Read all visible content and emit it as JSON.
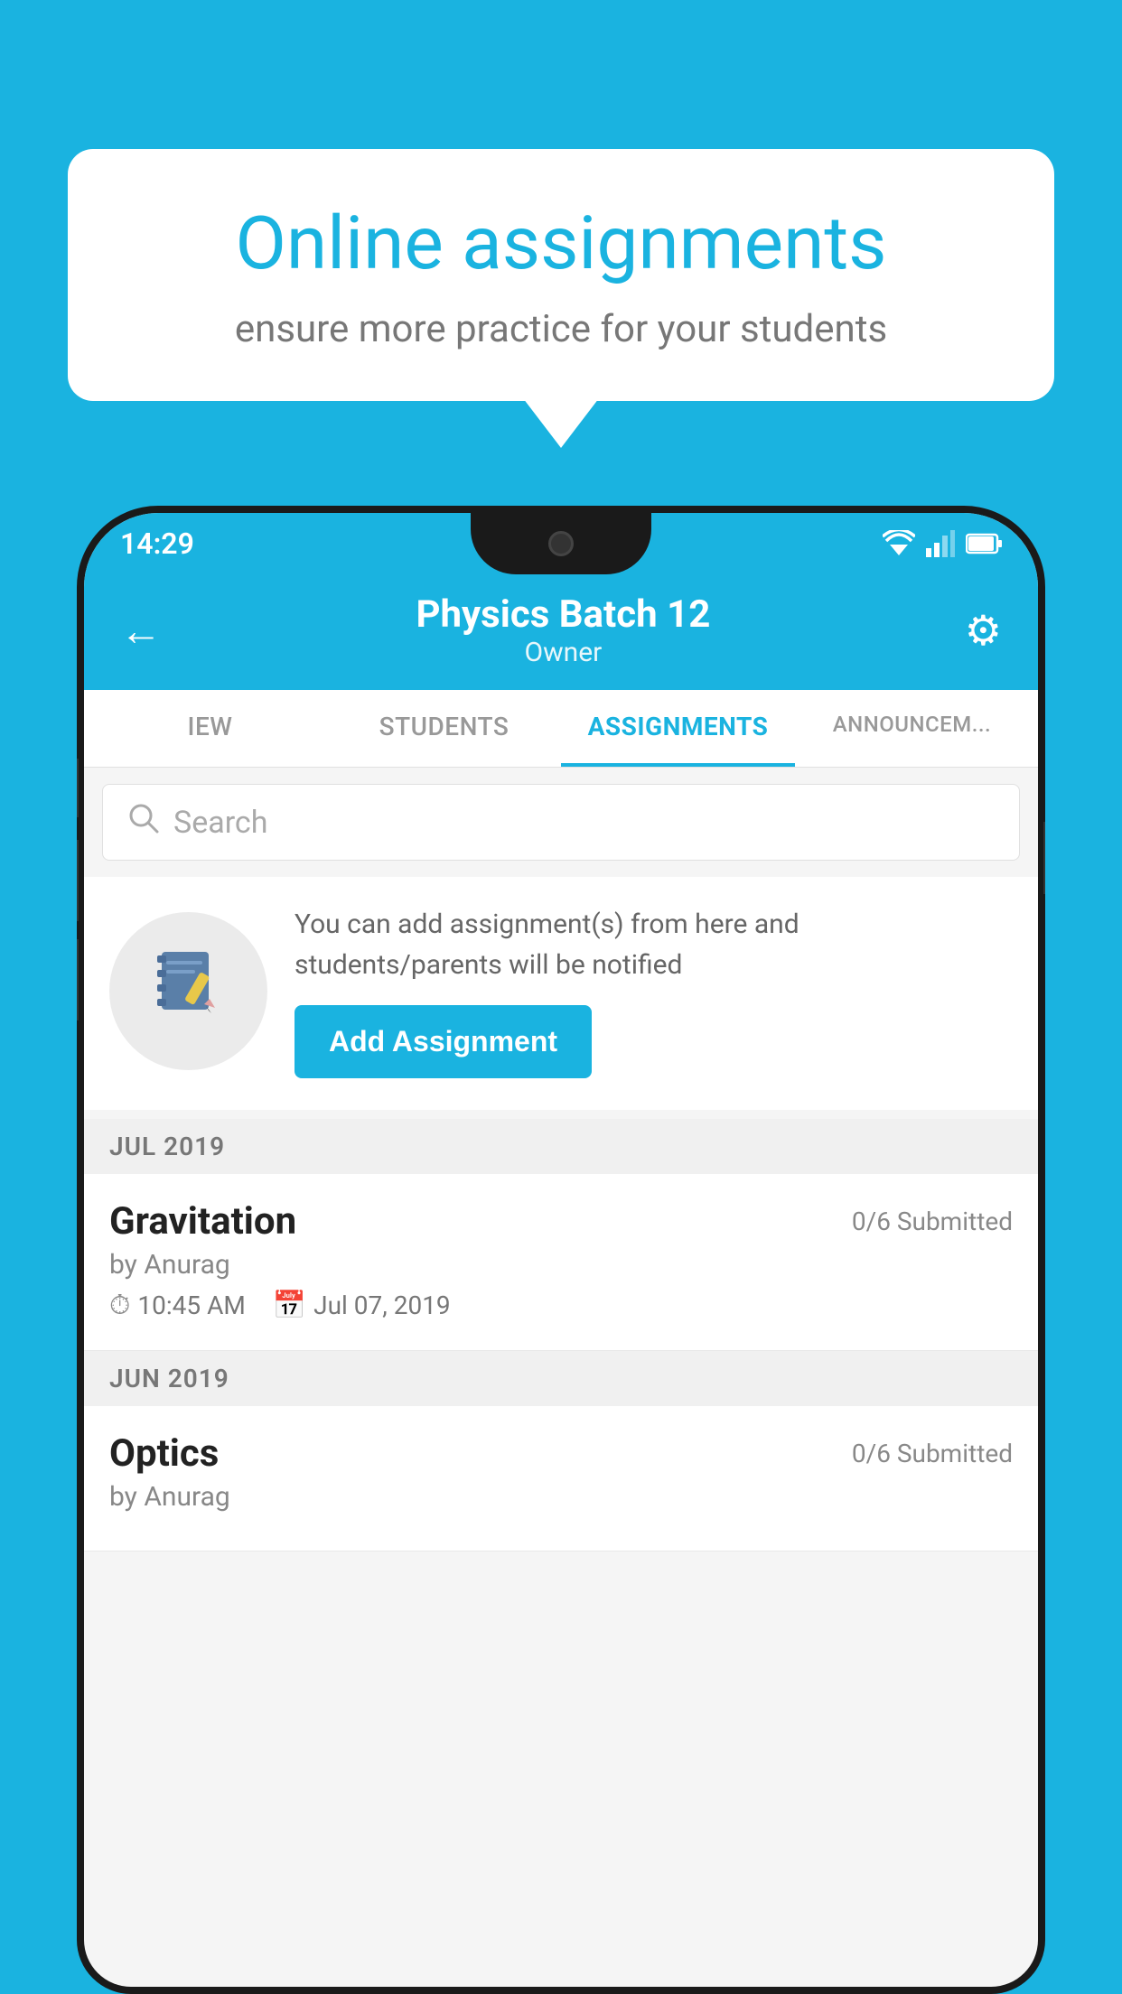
{
  "background_color": "#1ab3e0",
  "speech_bubble": {
    "title": "Online assignments",
    "subtitle": "ensure more practice for your students"
  },
  "phone": {
    "status_bar": {
      "time": "14:29"
    },
    "header": {
      "title": "Physics Batch 12",
      "subtitle": "Owner",
      "back_label": "←",
      "gear_label": "⚙"
    },
    "tabs": [
      {
        "label": "IEW",
        "active": false
      },
      {
        "label": "STUDENTS",
        "active": false
      },
      {
        "label": "ASSIGNMENTS",
        "active": true
      },
      {
        "label": "ANNOUNCEM...",
        "active": false
      }
    ],
    "search": {
      "placeholder": "Search"
    },
    "empty_state": {
      "description": "You can add assignment(s) from here and students/parents will be notified",
      "button_label": "Add Assignment"
    },
    "sections": [
      {
        "title": "JUL 2019",
        "assignments": [
          {
            "name": "Gravitation",
            "submitted": "0/6 Submitted",
            "by": "by Anurag",
            "time": "10:45 AM",
            "date": "Jul 07, 2019"
          }
        ]
      },
      {
        "title": "JUN 2019",
        "assignments": [
          {
            "name": "Optics",
            "submitted": "0/6 Submitted",
            "by": "by Anurag",
            "time": "",
            "date": ""
          }
        ]
      }
    ]
  }
}
